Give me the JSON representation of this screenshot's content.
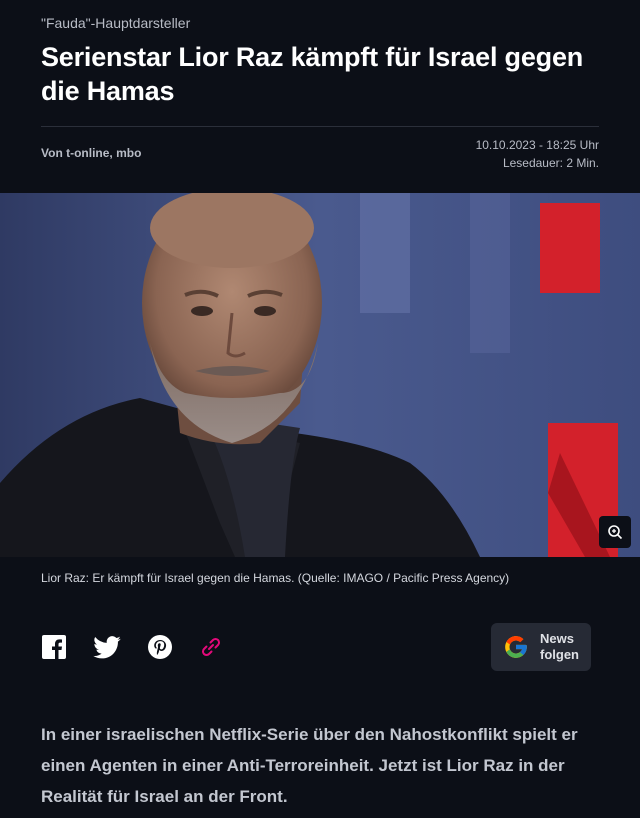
{
  "article": {
    "kicker": "\"Fauda\"-Hauptdarsteller",
    "headline": "Serienstar Lior Raz kämpft für Israel gegen die Hamas",
    "author": "Von t-online, mbo",
    "date": "10.10.2023 - 18:25 Uhr",
    "reading_time": "Lesedauer: 2 Min.",
    "caption": "Lior Raz: Er kämpft für Israel gegen die Hamas. (Quelle: IMAGO / Pacific Press Agency)",
    "intro": "In einer israelischen Netflix-Serie über den Nahostkonflikt spielt er einen Agenten in einer Anti-Terroreinheit. Jetzt ist Lior Raz in der Realität für Israel an der Front."
  },
  "share": {
    "icons": [
      "facebook-icon",
      "twitter-icon",
      "pinterest-icon",
      "link-icon"
    ],
    "google_news_line1": "News",
    "google_news_line2": "folgen"
  },
  "colors": {
    "background": "#0c0f17",
    "link_accent": "#e4097a",
    "netflix_red": "#d3212b"
  }
}
